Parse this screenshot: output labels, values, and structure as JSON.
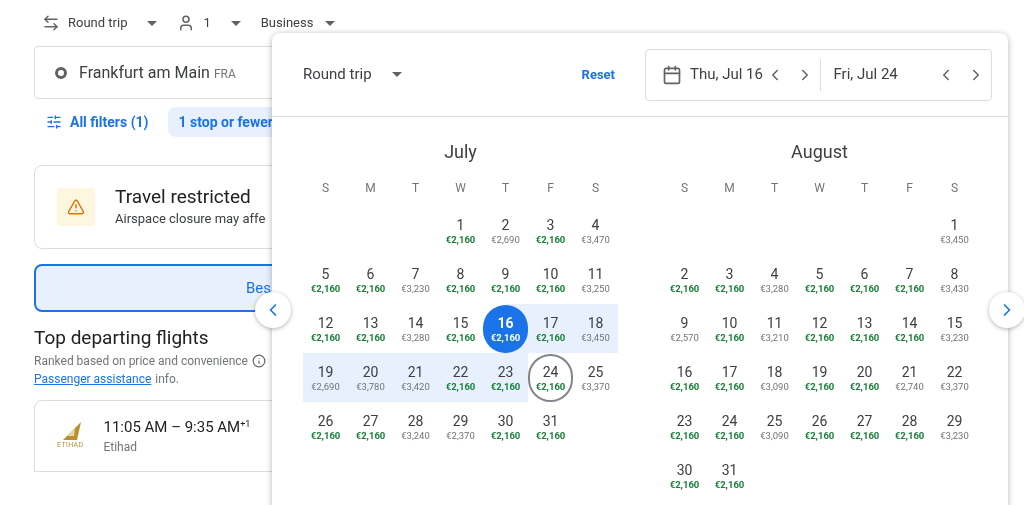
{
  "search_bar": {
    "trip_type": "Round trip",
    "passengers": "1",
    "cabin": "Business"
  },
  "origin": {
    "city": "Frankfurt am Main",
    "code": "FRA"
  },
  "filters": [
    {
      "label": "All filters (1)",
      "kind": "all"
    },
    {
      "label": "1 stop or fewer",
      "kind": "chip"
    }
  ],
  "alert": {
    "title": "Travel restricted",
    "text": "Airspace closure may affe"
  },
  "sort_tab": {
    "label": "Bes",
    "selected": true
  },
  "results": {
    "title": "Top departing flights",
    "subtitle": "Ranked based on price and convenience",
    "link": "Passenger assistance",
    "link_suffix": "info."
  },
  "flights": [
    {
      "times": "11:05 AM – 9:35 AM",
      "day_offset": "+1",
      "airline": "Etihad",
      "logo_text": "ETIHAD"
    }
  ],
  "date_picker": {
    "trip_type": "Round trip",
    "reset": "Reset",
    "depart": "Thu, Jul 16",
    "return": "Fri, Jul 24",
    "months": [
      {
        "name": "July",
        "weekdays": [
          "S",
          "M",
          "T",
          "W",
          "T",
          "F",
          "S"
        ],
        "weeks": [
          [
            {
              "kind": "blank"
            },
            {
              "kind": "blank"
            },
            {
              "kind": "blank"
            },
            {
              "day": "1",
              "price": "€2,160",
              "low": true,
              "kind": "plain"
            },
            {
              "day": "2",
              "price": "€2,690",
              "low": false,
              "kind": "plain"
            },
            {
              "day": "3",
              "price": "€2,160",
              "low": true,
              "kind": "plain"
            },
            {
              "day": "4",
              "price": "€3,470",
              "low": false,
              "kind": "plain"
            }
          ],
          [
            {
              "day": "5",
              "price": "€2,160",
              "low": true,
              "kind": "plain"
            },
            {
              "day": "6",
              "price": "€2,160",
              "low": true,
              "kind": "plain"
            },
            {
              "day": "7",
              "price": "€3,230",
              "low": false,
              "kind": "plain"
            },
            {
              "day": "8",
              "price": "€2,160",
              "low": true,
              "kind": "plain"
            },
            {
              "day": "9",
              "price": "€2,160",
              "low": true,
              "kind": "plain"
            },
            {
              "day": "10",
              "price": "€2,160",
              "low": true,
              "kind": "plain"
            },
            {
              "day": "11",
              "price": "€3,250",
              "low": false,
              "kind": "plain"
            }
          ],
          [
            {
              "day": "12",
              "price": "€2,160",
              "low": true,
              "kind": "plain"
            },
            {
              "day": "13",
              "price": "€2,160",
              "low": true,
              "kind": "plain"
            },
            {
              "day": "14",
              "price": "€3,280",
              "low": false,
              "kind": "plain"
            },
            {
              "day": "15",
              "price": "€2,160",
              "low": true,
              "kind": "plain"
            },
            {
              "day": "16",
              "price": "€2,160",
              "low": true,
              "kind": "depart"
            },
            {
              "day": "17",
              "price": "€2,160",
              "low": true,
              "kind": "range"
            },
            {
              "day": "18",
              "price": "€3,450",
              "low": false,
              "kind": "range"
            }
          ],
          [
            {
              "day": "19",
              "price": "€2,690",
              "low": false,
              "kind": "range"
            },
            {
              "day": "20",
              "price": "€3,780",
              "low": false,
              "kind": "range"
            },
            {
              "day": "21",
              "price": "€3,420",
              "low": false,
              "kind": "range"
            },
            {
              "day": "22",
              "price": "€2,160",
              "low": true,
              "kind": "range"
            },
            {
              "day": "23",
              "price": "€2,160",
              "low": true,
              "kind": "range"
            },
            {
              "day": "24",
              "price": "€2,160",
              "low": true,
              "kind": "return"
            },
            {
              "day": "25",
              "price": "€3,370",
              "low": false,
              "kind": "plain"
            }
          ],
          [
            {
              "day": "26",
              "price": "€2,160",
              "low": true,
              "kind": "plain"
            },
            {
              "day": "27",
              "price": "€2,160",
              "low": true,
              "kind": "plain"
            },
            {
              "day": "28",
              "price": "€3,240",
              "low": false,
              "kind": "plain"
            },
            {
              "day": "29",
              "price": "€2,370",
              "low": false,
              "kind": "plain"
            },
            {
              "day": "30",
              "price": "€2,160",
              "low": true,
              "kind": "plain"
            },
            {
              "day": "31",
              "price": "€2,160",
              "low": true,
              "kind": "plain"
            }
          ]
        ]
      },
      {
        "name": "August",
        "weekdays": [
          "S",
          "M",
          "T",
          "W",
          "T",
          "F",
          "S"
        ],
        "weeks": [
          [
            {
              "kind": "blank"
            },
            {
              "kind": "blank"
            },
            {
              "kind": "blank"
            },
            {
              "kind": "blank"
            },
            {
              "kind": "blank"
            },
            {
              "kind": "blank"
            },
            {
              "day": "1",
              "price": "€3,450",
              "low": false,
              "kind": "plain"
            }
          ],
          [
            {
              "day": "2",
              "price": "€2,160",
              "low": true,
              "kind": "plain"
            },
            {
              "day": "3",
              "price": "€2,160",
              "low": true,
              "kind": "plain"
            },
            {
              "day": "4",
              "price": "€3,280",
              "low": false,
              "kind": "plain"
            },
            {
              "day": "5",
              "price": "€2,160",
              "low": true,
              "kind": "plain"
            },
            {
              "day": "6",
              "price": "€2,160",
              "low": true,
              "kind": "plain"
            },
            {
              "day": "7",
              "price": "€2,160",
              "low": true,
              "kind": "plain"
            },
            {
              "day": "8",
              "price": "€3,430",
              "low": false,
              "kind": "plain"
            }
          ],
          [
            {
              "day": "9",
              "price": "€2,570",
              "low": false,
              "kind": "plain"
            },
            {
              "day": "10",
              "price": "€2,160",
              "low": true,
              "kind": "plain"
            },
            {
              "day": "11",
              "price": "€3,210",
              "low": false,
              "kind": "plain"
            },
            {
              "day": "12",
              "price": "€2,160",
              "low": true,
              "kind": "plain"
            },
            {
              "day": "13",
              "price": "€2,160",
              "low": true,
              "kind": "plain"
            },
            {
              "day": "14",
              "price": "€2,160",
              "low": true,
              "kind": "plain"
            },
            {
              "day": "15",
              "price": "€3,230",
              "low": false,
              "kind": "plain"
            }
          ],
          [
            {
              "day": "16",
              "price": "€2,160",
              "low": true,
              "kind": "plain"
            },
            {
              "day": "17",
              "price": "€2,160",
              "low": true,
              "kind": "plain"
            },
            {
              "day": "18",
              "price": "€3,090",
              "low": false,
              "kind": "plain"
            },
            {
              "day": "19",
              "price": "€2,160",
              "low": true,
              "kind": "plain"
            },
            {
              "day": "20",
              "price": "€2,160",
              "low": true,
              "kind": "plain"
            },
            {
              "day": "21",
              "price": "€2,740",
              "low": false,
              "kind": "plain"
            },
            {
              "day": "22",
              "price": "€3,370",
              "low": false,
              "kind": "plain"
            }
          ],
          [
            {
              "day": "23",
              "price": "€2,160",
              "low": true,
              "kind": "plain"
            },
            {
              "day": "24",
              "price": "€2,160",
              "low": true,
              "kind": "plain"
            },
            {
              "day": "25",
              "price": "€3,090",
              "low": false,
              "kind": "plain"
            },
            {
              "day": "26",
              "price": "€2,160",
              "low": true,
              "kind": "plain"
            },
            {
              "day": "27",
              "price": "€2,160",
              "low": true,
              "kind": "plain"
            },
            {
              "day": "28",
              "price": "€2,160",
              "low": true,
              "kind": "plain"
            },
            {
              "day": "29",
              "price": "€3,230",
              "low": false,
              "kind": "plain"
            }
          ],
          [
            {
              "day": "30",
              "price": "€2,160",
              "low": true,
              "kind": "plain"
            },
            {
              "day": "31",
              "price": "€2,160",
              "low": true,
              "kind": "plain"
            }
          ]
        ]
      }
    ]
  }
}
